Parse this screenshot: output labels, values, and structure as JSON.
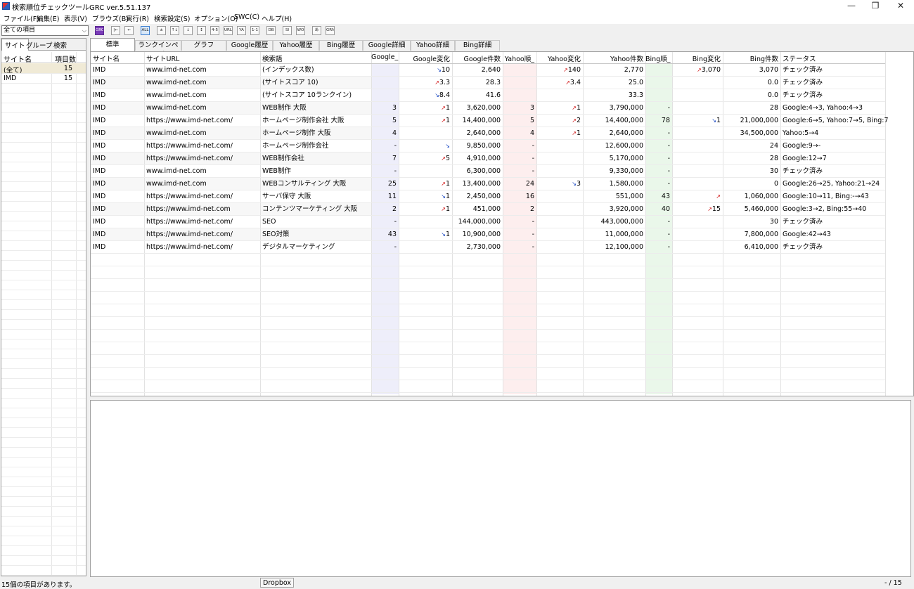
{
  "window": {
    "title": "検索順位チェックツールGRC ver.5.51.137",
    "minimize": "—",
    "maximize": "❐",
    "close": "✕"
  },
  "menu": [
    "ファイル(F)",
    "編集(E)",
    "表示(V)",
    "ブラウズ(B)",
    "実行(R)",
    "検索設定(S)",
    "オプション(O)",
    "SWC(C)",
    "ヘルプ(H)"
  ],
  "toolbar": {
    "filter_value": "全ての項目",
    "buttons": [
      "GRC",
      "|←",
      "←",
      "ALL",
      "±",
      "↑↓",
      "↓",
      "↕",
      "4-5",
      "URL",
      "YA PE",
      "1-1",
      "DB TA",
      "SI TE",
      "WO RD",
      "あ",
      "GRN UP"
    ]
  },
  "left_panel": {
    "tabs": [
      "サイト",
      "グループ",
      "検索"
    ],
    "columns": [
      "サイト名",
      "項目数"
    ],
    "rows": [
      {
        "name": "(全て)",
        "count": "15"
      },
      {
        "name": "IMD",
        "count": "15"
      }
    ]
  },
  "main_tabs": [
    "標準",
    "ランクインページ",
    "グラフ",
    "Google履歴",
    "Yahoo履歴",
    "Bing履歴",
    "Google詳細",
    "Yahoo詳細",
    "Bing詳細"
  ],
  "table": {
    "columns": [
      "サイト名",
      "サイトURL",
      "検索語",
      "Google_",
      "Google変化",
      "Google件数",
      "Yahoo順_",
      "Yahoo変化",
      "Yahoo件数",
      "Bing順_",
      "Bing変化",
      "Bing件数",
      "ステータス"
    ],
    "rows": [
      [
        "IMD",
        "www.imd-net.com",
        "(インデックス数)",
        "",
        {
          "dir": "down",
          "v": "10"
        },
        "2,640",
        "",
        {
          "dir": "up",
          "v": "140"
        },
        "2,770",
        "",
        {
          "dir": "up",
          "v": "3,070"
        },
        "3,070",
        "チェック済み"
      ],
      [
        "IMD",
        "www.imd-net.com",
        "(サイトスコア 10)",
        "",
        {
          "dir": "up",
          "v": "3.3"
        },
        "28.3",
        "",
        {
          "dir": "up",
          "v": "3.4"
        },
        "25.0",
        "",
        null,
        "0.0",
        "チェック済み"
      ],
      [
        "IMD",
        "www.imd-net.com",
        "(サイトスコア 10ランクイン)",
        "",
        {
          "dir": "down",
          "v": "8.4"
        },
        "41.6",
        "",
        null,
        "33.3",
        "",
        null,
        "0.0",
        "チェック済み"
      ],
      [
        "IMD",
        "www.imd-net.com",
        "WEB制作 大阪",
        "3",
        {
          "dir": "up",
          "v": "1"
        },
        "3,620,000",
        "3",
        {
          "dir": "up",
          "v": "1"
        },
        "3,790,000",
        "-",
        null,
        "28",
        "Google:4→3, Yahoo:4→3"
      ],
      [
        "IMD",
        "https://www.imd-net.com/",
        "ホームページ制作会社 大阪",
        "5",
        {
          "dir": "up",
          "v": "1"
        },
        "14,400,000",
        "5",
        {
          "dir": "up",
          "v": "2"
        },
        "14,400,000",
        "78",
        {
          "dir": "down",
          "v": "1"
        },
        "21,000,000",
        "Google:6→5, Yahoo:7→5, Bing:7"
      ],
      [
        "IMD",
        "www.imd-net.com",
        "ホームページ制作 大阪",
        "4",
        null,
        "2,640,000",
        "4",
        {
          "dir": "up",
          "v": "1"
        },
        "2,640,000",
        "-",
        null,
        "34,500,000",
        "Yahoo:5→4"
      ],
      [
        "IMD",
        "https://www.imd-net.com/",
        "ホームページ制作会社",
        "-",
        {
          "dir": "down",
          "v": ""
        },
        "9,850,000",
        "-",
        null,
        "12,600,000",
        "-",
        null,
        "24",
        "Google:9→-"
      ],
      [
        "IMD",
        "https://www.imd-net.com/",
        "WEB制作会社",
        "7",
        {
          "dir": "up",
          "v": "5"
        },
        "4,910,000",
        "-",
        null,
        "5,170,000",
        "-",
        null,
        "28",
        "Google:12→7"
      ],
      [
        "IMD",
        "www.imd-net.com",
        "WEB制作",
        "-",
        null,
        "6,300,000",
        "-",
        null,
        "9,330,000",
        "-",
        null,
        "30",
        "チェック済み"
      ],
      [
        "IMD",
        "www.imd-net.com",
        "WEBコンサルティング 大阪",
        "25",
        {
          "dir": "up",
          "v": "1"
        },
        "13,400,000",
        "24",
        {
          "dir": "down",
          "v": "3"
        },
        "1,580,000",
        "-",
        null,
        "0",
        "Google:26→25, Yahoo:21→24"
      ],
      [
        "IMD",
        "https://www.imd-net.com/",
        "サーバ保守 大阪",
        "11",
        {
          "dir": "down",
          "v": "1"
        },
        "2,450,000",
        "16",
        null,
        "551,000",
        "43",
        {
          "dir": "up",
          "v": ""
        },
        "1,060,000",
        "Google:10→11, Bing:-→43"
      ],
      [
        "IMD",
        "https://www.imd-net.com",
        "コンテンツマーケティング 大阪",
        "2",
        {
          "dir": "up",
          "v": "1"
        },
        "451,000",
        "2",
        null,
        "3,920,000",
        "40",
        {
          "dir": "up",
          "v": "15"
        },
        "5,460,000",
        "Google:3→2, Bing:55→40"
      ],
      [
        "IMD",
        "https://www.imd-net.com/",
        "SEO",
        "-",
        null,
        "144,000,000",
        "-",
        null,
        "443,000,000",
        "-",
        null,
        "30",
        "チェック済み"
      ],
      [
        "IMD",
        "https://www.imd-net.com/",
        "SEO対策",
        "43",
        {
          "dir": "down",
          "v": "1"
        },
        "10,900,000",
        "-",
        null,
        "11,000,000",
        "-",
        null,
        "7,800,000",
        "Google:42→43"
      ],
      [
        "IMD",
        "https://www.imd-net.com/",
        "デジタルマーケティング",
        "-",
        null,
        "2,730,000",
        "-",
        null,
        "12,100,000",
        "-",
        null,
        "6,410,000",
        "チェック済み"
      ]
    ]
  },
  "status": {
    "message": "15個の項目があります。",
    "dropbox": "Dropbox",
    "count": "- / 15"
  },
  "colors": {
    "google_col": "#eeeefa",
    "yahoo_col": "#fdeeee",
    "bing_col": "#eaf7ea",
    "up": "#d01010",
    "down": "#1040c0"
  }
}
